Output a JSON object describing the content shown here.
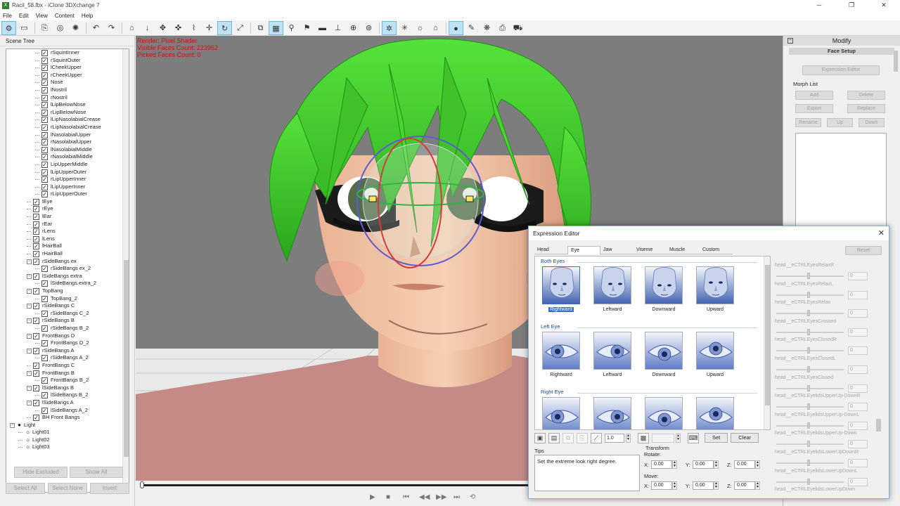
{
  "window": {
    "title": "Racil_58.fbx - iClone 3DXchange 7",
    "controls": [
      "─",
      "❐",
      "✕"
    ]
  },
  "menu": [
    "File",
    "Edit",
    "View",
    "Content",
    "Help"
  ],
  "toolbar": [
    {
      "name": "scene-tree-tool",
      "glyph": "⚙",
      "active": true
    },
    {
      "name": "folder-tool",
      "glyph": "▭"
    },
    {
      "sep": true
    },
    {
      "name": "import-tool",
      "glyph": "⎘"
    },
    {
      "name": "export-tool",
      "glyph": "◎"
    },
    {
      "name": "convert-tool",
      "glyph": "✺"
    },
    {
      "sep": true
    },
    {
      "name": "undo-tool",
      "glyph": "↶"
    },
    {
      "name": "redo-tool",
      "glyph": "↷"
    },
    {
      "sep": true
    },
    {
      "name": "home-tool",
      "glyph": "⌂"
    },
    {
      "name": "down-tool",
      "glyph": "↓"
    },
    {
      "name": "move-tool",
      "glyph": "✥"
    },
    {
      "name": "pan-tool",
      "glyph": "✜"
    },
    {
      "name": "link-tool",
      "glyph": "⌇"
    },
    {
      "name": "transform-tool",
      "glyph": "✛"
    },
    {
      "name": "rotate-tool",
      "glyph": "↻",
      "active": true
    },
    {
      "name": "scale-tool",
      "glyph": "⤢"
    },
    {
      "sep": true
    },
    {
      "name": "zoom-tool",
      "glyph": "⧉"
    },
    {
      "name": "grid-tool",
      "glyph": "▦",
      "active": true
    },
    {
      "name": "bone-tool",
      "glyph": "⚲"
    },
    {
      "name": "pin-tool",
      "glyph": "⚑"
    },
    {
      "name": "camera-tool",
      "glyph": "▬"
    },
    {
      "name": "align-tool",
      "glyph": "⊥"
    },
    {
      "name": "globe-tool",
      "glyph": "⊕"
    },
    {
      "name": "target-tool",
      "glyph": "⊚"
    },
    {
      "sep": true
    },
    {
      "name": "light-tool",
      "glyph": "✲",
      "active": true
    },
    {
      "name": "spot-tool",
      "glyph": "✳"
    },
    {
      "name": "sun-tool",
      "glyph": "☼"
    },
    {
      "name": "museum-tool",
      "glyph": "⌂"
    },
    {
      "sep": true
    },
    {
      "name": "sphere-tool",
      "glyph": "●",
      "active": true
    },
    {
      "name": "brush-tool",
      "glyph": "✎"
    },
    {
      "name": "paint-tool",
      "glyph": "❋"
    },
    {
      "name": "stamp-tool",
      "glyph": "⎙"
    },
    {
      "name": "cart-tool",
      "glyph": "⛟"
    }
  ],
  "scene_tree": {
    "header": "Scene Tree",
    "rows": [
      {
        "label": "rSquintInner",
        "d": 3,
        "t": ""
      },
      {
        "label": "rSquintOuter",
        "d": 3,
        "t": ""
      },
      {
        "label": "lCheekUpper",
        "d": 3,
        "t": ""
      },
      {
        "label": "rCheekUpper",
        "d": 3,
        "t": ""
      },
      {
        "label": "Nose",
        "d": 3,
        "t": ""
      },
      {
        "label": "lNostril",
        "d": 3,
        "t": ""
      },
      {
        "label": "rNostril",
        "d": 3,
        "t": ""
      },
      {
        "label": "lLipBelowNose",
        "d": 3,
        "t": ""
      },
      {
        "label": "rLipBelowNose",
        "d": 3,
        "t": ""
      },
      {
        "label": "lLipNasolabialCrease",
        "d": 3,
        "t": ""
      },
      {
        "label": "rLipNasolabialCrease",
        "d": 3,
        "t": ""
      },
      {
        "label": "lNasolabialUpper",
        "d": 3,
        "t": ""
      },
      {
        "label": "rNasolabialUpper",
        "d": 3,
        "t": ""
      },
      {
        "label": "lNasolabialMiddle",
        "d": 3,
        "t": ""
      },
      {
        "label": "rNasolabialMiddle",
        "d": 3,
        "t": ""
      },
      {
        "label": "LipUpperMiddle",
        "d": 3,
        "t": ""
      },
      {
        "label": "lLipUpperOuter",
        "d": 3,
        "t": ""
      },
      {
        "label": "rLipUpperInner",
        "d": 3,
        "t": ""
      },
      {
        "label": "lLipUpperInner",
        "d": 3,
        "t": ""
      },
      {
        "label": "rLipUpperOuter",
        "d": 3,
        "t": ""
      },
      {
        "label": "lEye",
        "d": 2,
        "t": ""
      },
      {
        "label": "rEye",
        "d": 2,
        "t": ""
      },
      {
        "label": "lEar",
        "d": 2,
        "t": ""
      },
      {
        "label": "rEar",
        "d": 2,
        "t": ""
      },
      {
        "label": "rLens",
        "d": 2,
        "t": ""
      },
      {
        "label": "lLens",
        "d": 2,
        "t": ""
      },
      {
        "label": "lHairBall",
        "d": 2,
        "t": ""
      },
      {
        "label": "rHairBall",
        "d": 2,
        "t": ""
      },
      {
        "label": "rSideBangs ex",
        "d": 2,
        "t": "−"
      },
      {
        "label": "rSideBangs ex_2",
        "d": 3,
        "t": ""
      },
      {
        "label": "lSideBangs extra",
        "d": 2,
        "t": "−"
      },
      {
        "label": "lSideBangs extra_2",
        "d": 3,
        "t": ""
      },
      {
        "label": "TopBang",
        "d": 2,
        "t": "−"
      },
      {
        "label": "TopBang_2",
        "d": 3,
        "t": ""
      },
      {
        "label": "rSideBangs C",
        "d": 2,
        "t": "−"
      },
      {
        "label": "rSideBangs C_2",
        "d": 3,
        "t": ""
      },
      {
        "label": "rSideBangs B",
        "d": 2,
        "t": "−"
      },
      {
        "label": "rSideBangs B_2",
        "d": 3,
        "t": ""
      },
      {
        "label": "FrontBangs D",
        "d": 2,
        "t": "−"
      },
      {
        "label": "FrontBangs D_2",
        "d": 3,
        "t": ""
      },
      {
        "label": "rSideBangs A",
        "d": 2,
        "t": "−"
      },
      {
        "label": "rSideBangs A_2",
        "d": 3,
        "t": ""
      },
      {
        "label": "FrontBangs C",
        "d": 2,
        "t": ""
      },
      {
        "label": "FrontBangs B",
        "d": 2,
        "t": "−"
      },
      {
        "label": "FrontBangs B_2",
        "d": 3,
        "t": ""
      },
      {
        "label": "lSideBangs B",
        "d": 2,
        "t": "−"
      },
      {
        "label": "lSideBangs B_2",
        "d": 3,
        "t": ""
      },
      {
        "label": "lSideBangs A",
        "d": 2,
        "t": "−"
      },
      {
        "label": "lSideBangs A_2",
        "d": 3,
        "t": ""
      },
      {
        "label": "BH Front Bangs",
        "d": 2,
        "t": ""
      },
      {
        "label": "Light",
        "d": 0,
        "t": "−",
        "nocb": true
      },
      {
        "label": "Light01",
        "d": 1,
        "t": "",
        "nocb": true
      },
      {
        "label": "Light02",
        "d": 1,
        "t": "",
        "nocb": true
      },
      {
        "label": "Light03",
        "d": 1,
        "t": "",
        "nocb": true
      }
    ],
    "btn_hide_excluded": "Hide Excluded",
    "btn_show_all": "Show All",
    "btn_select_all": "Select All",
    "btn_select_none": "Select None",
    "btn_invert": "Invert"
  },
  "viewport": {
    "render": "Render: Pixel Shader",
    "visible_faces": "Visible Faces Count: 223962",
    "picked_faces": "Picked Faces Count: 0"
  },
  "playback": [
    "▶",
    "■",
    "⏮",
    "◀◀",
    "▶▶",
    "⏭",
    "⟲"
  ],
  "modify": {
    "header": "Modify",
    "face_setup": "Face Setup",
    "expression_editor_btn": "Expression Editor",
    "morph_list_label": "Morph List",
    "btn_add": "Add",
    "btn_delete": "Delete",
    "btn_export": "Export",
    "btn_replace": "Replace",
    "btn_rename": "Rename",
    "btn_up": "Up",
    "btn_down": "Down"
  },
  "expression_editor": {
    "title": "Expression Editor",
    "close": "✕",
    "tabs": [
      "Head",
      "Eye",
      "Jaw",
      "Viseme",
      "Muscle",
      "Custom"
    ],
    "selected_tab": "Eye",
    "reset": "Reset",
    "sections": [
      {
        "title": "Both Eyes",
        "items": [
          "Rightward",
          "Leftward",
          "Downward",
          "Upward"
        ],
        "kind": "face"
      },
      {
        "title": "Left Eye",
        "items": [
          "Rightward",
          "Leftward",
          "Downward",
          "Upward"
        ],
        "kind": "eye"
      },
      {
        "title": "Right Eye",
        "items": [
          "",
          "",
          "",
          ""
        ],
        "kind": "eye"
      }
    ],
    "selected_item": "Rightward",
    "strength": "1.0",
    "btn_set": "Set",
    "btn_clear": "Clear",
    "tips_label": "Tips",
    "tips_text": "Set the extreme look right degree.",
    "transform_label": "Transform",
    "rotate_label": "Rotate:",
    "move_label": "Move:",
    "rotate": {
      "x": "0.00",
      "y": "0.00",
      "z": "0.00"
    },
    "move": {
      "x": "0.00",
      "y": "0.00",
      "z": "0.00"
    },
    "sliders": [
      {
        "name": "head__eCTRLEyesRelaxR",
        "value": "0"
      },
      {
        "name": "head__eCTRLEyesRelaxL",
        "value": "0"
      },
      {
        "name": "head__eCTRLEyesRelax",
        "value": "0"
      },
      {
        "name": "head__eCTRLEyesCrossed",
        "value": "0"
      },
      {
        "name": "head__eCTRLEyesClosedR",
        "value": "0"
      },
      {
        "name": "head__eCTRLEyesClosedL",
        "value": "0"
      },
      {
        "name": "head__eCTRLEyesClosed",
        "value": "0"
      },
      {
        "name": "head__eCTRLEyelidsUpperUp-DownR",
        "value": "0"
      },
      {
        "name": "head__eCTRLEyelidsUpperUp-DownL",
        "value": "0"
      },
      {
        "name": "head__eCTRLEyelidsUpperUp-Down",
        "value": "0"
      },
      {
        "name": "head__eCTRLEyelidsLowerUpDownR",
        "value": "0"
      },
      {
        "name": "head__eCTRLEyelidsLowerUpDownL",
        "value": "0"
      },
      {
        "name": "head__eCTRLEyelidsLowerUpDown",
        "value": ""
      }
    ]
  },
  "colors": {
    "accent": "#3a6fc4",
    "hair": "#3fcf2a",
    "skin": "#f3c7a6",
    "sweater": "#c48a86",
    "overlay_text": "#d01010"
  }
}
